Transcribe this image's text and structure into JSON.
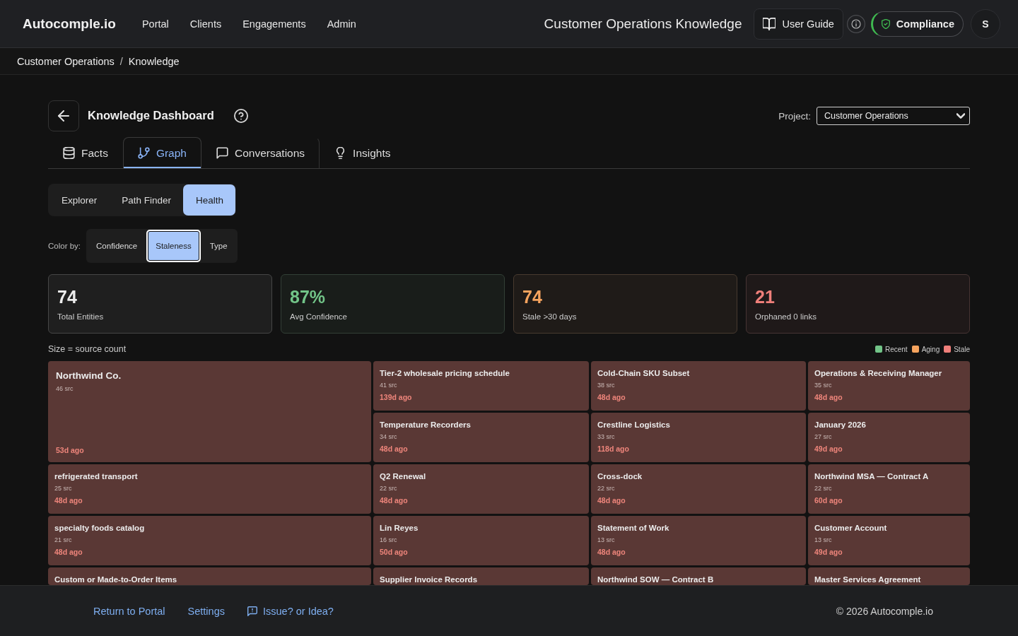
{
  "nav": {
    "logo": "Autocomple.io",
    "links": [
      "Portal",
      "Clients",
      "Engagements",
      "Admin"
    ],
    "page_title": "Customer Operations Knowledge",
    "user_guide": "User Guide",
    "compliance": "Compliance",
    "avatar": "S"
  },
  "breadcrumb": {
    "items": [
      "Customer Operations",
      "Knowledge"
    ],
    "separator": "/"
  },
  "dashboard": {
    "title": "Knowledge Dashboard",
    "project_label": "Project:",
    "project": "Customer Operations"
  },
  "tabs": [
    {
      "label": "Facts",
      "selected": false
    },
    {
      "label": "Graph",
      "selected": true
    },
    {
      "label": "Conversations",
      "selected": false
    },
    {
      "label": "Insights",
      "selected": false
    }
  ],
  "views": [
    {
      "label": "Explorer",
      "selected": false
    },
    {
      "label": "Path Finder",
      "selected": false
    },
    {
      "label": "Health",
      "selected": true
    }
  ],
  "color_by": {
    "label": "Color by:",
    "options": [
      {
        "label": "Confidence",
        "selected": false
      },
      {
        "label": "Staleness",
        "selected": true
      },
      {
        "label": "Type",
        "selected": false
      }
    ]
  },
  "stats": [
    {
      "value": "74",
      "label": "Total Entities",
      "color": "#ececec"
    },
    {
      "value": "87%",
      "label": "Avg Confidence",
      "color": "#72c488"
    },
    {
      "value": "74",
      "label": "Stale >30 days",
      "color": "#f5a35e"
    },
    {
      "value": "21",
      "label": "Orphaned 0 links",
      "color": "#ef7f7a"
    }
  ],
  "treemap": {
    "caption": "Size = source count",
    "legend": [
      {
        "label": "Recent",
        "color": "#72c488"
      },
      {
        "label": "Aging",
        "color": "#f5a35e"
      },
      {
        "label": "Stale",
        "color": "#ef7f7a"
      }
    ],
    "tiles": [
      {
        "name": "Northwind Co.",
        "sources": "46 src",
        "age": "53d ago",
        "color": "#5a3835"
      },
      {
        "name": "Tier-2 wholesale pricing schedule",
        "sources": "41 src",
        "age": "139d ago",
        "color": "#5a3835"
      },
      {
        "name": "Cold-Chain SKU Subset",
        "sources": "38 src",
        "age": "48d ago",
        "color": "#5a3835"
      },
      {
        "name": "Operations & Receiving Manager",
        "sources": "35 src",
        "age": "48d ago",
        "color": "#5a3835"
      },
      {
        "name": "Temperature Recorders",
        "sources": "34 src",
        "age": "48d ago",
        "color": "#5a3835"
      },
      {
        "name": "Crestline Logistics",
        "sources": "33 src",
        "age": "118d ago",
        "color": "#5a3835"
      },
      {
        "name": "January 2026",
        "sources": "27 src",
        "age": "49d ago",
        "color": "#5a3835"
      },
      {
        "name": "refrigerated transport",
        "sources": "25 src",
        "age": "48d ago",
        "color": "#5a3835"
      },
      {
        "name": "Q2 Renewal",
        "sources": "22 src",
        "age": "48d ago",
        "color": "#5a3835"
      },
      {
        "name": "Cross-dock",
        "sources": "22 src",
        "age": "48d ago",
        "color": "#5a3835"
      },
      {
        "name": "Northwind MSA — Contract A",
        "sources": "22 src",
        "age": "60d ago",
        "color": "#5a3835"
      },
      {
        "name": "specialty foods catalog",
        "sources": "21 src",
        "age": "48d ago",
        "color": "#5a3835"
      },
      {
        "name": "Lin Reyes",
        "sources": "16 src",
        "age": "50d ago",
        "color": "#5a3835"
      },
      {
        "name": "Statement of Work",
        "sources": "13 src",
        "age": "48d ago",
        "color": "#5a3835"
      },
      {
        "name": "Customer Account",
        "sources": "13 src",
        "age": "49d ago",
        "color": "#5a3835"
      },
      {
        "name": "Custom or Made-to-Order Items",
        "color": "#5a3835"
      },
      {
        "name": "Supplier Invoice Records",
        "color": "#5a3835"
      },
      {
        "name": "Northwind SOW — Contract B",
        "color": "#5a3835"
      },
      {
        "name": "Master Services Agreement",
        "color": "#5a3835"
      }
    ]
  },
  "footer": {
    "links": [
      "Return to Portal",
      "Settings",
      "Issue? or Idea?"
    ],
    "copyright": "© 2026 Autocomple.io"
  }
}
